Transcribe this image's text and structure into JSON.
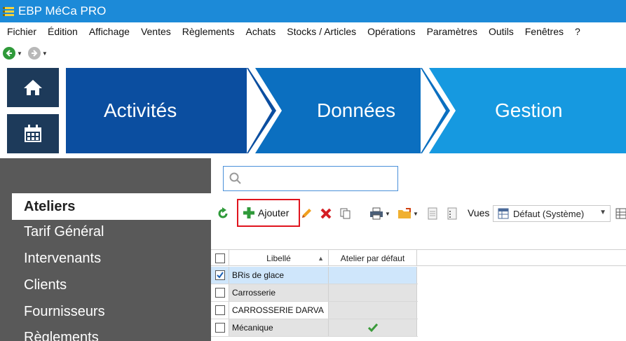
{
  "window": {
    "title": "EBP MéCa PRO"
  },
  "menu": [
    "Fichier",
    "Édition",
    "Affichage",
    "Ventes",
    "Règlements",
    "Achats",
    "Stocks / Articles",
    "Opérations",
    "Paramètres",
    "Outils",
    "Fenêtres",
    "?"
  ],
  "banner": {
    "steps": [
      "Activités",
      "Données",
      "Gestion"
    ]
  },
  "sidebar": {
    "items": [
      "Ateliers",
      "Tarif Général",
      "Intervenants",
      "Clients",
      "Fournisseurs",
      "Règlements"
    ],
    "active": "Ateliers"
  },
  "search": {
    "placeholder": ""
  },
  "toolbar": {
    "add_label": "Ajouter",
    "vues_label": "Vues",
    "view_value": "Défaut (Système)"
  },
  "grid": {
    "columns": [
      "Libellé",
      "Atelier par défaut"
    ],
    "sort_column": "Libellé",
    "rows": [
      {
        "libelle": "BRis de glace",
        "checked": true,
        "defaut": false,
        "selected": true
      },
      {
        "libelle": "Carrosserie",
        "checked": false,
        "defaut": false,
        "selected": false
      },
      {
        "libelle": "CARROSSERIE DARVA",
        "checked": false,
        "defaut": false,
        "selected": false
      },
      {
        "libelle": "Mécanique",
        "checked": false,
        "defaut": true,
        "selected": false
      }
    ]
  },
  "colors": {
    "titlebar": "#1c8ad8",
    "banner_dark": "#0b4ea0",
    "banner_mid": "#0b6fc0",
    "banner_light": "#1699e0",
    "sidebar": "#595959",
    "selected_row": "#cfe6fb",
    "odd_row": "#e3e3e3",
    "highlight_border": "#e0141e"
  }
}
